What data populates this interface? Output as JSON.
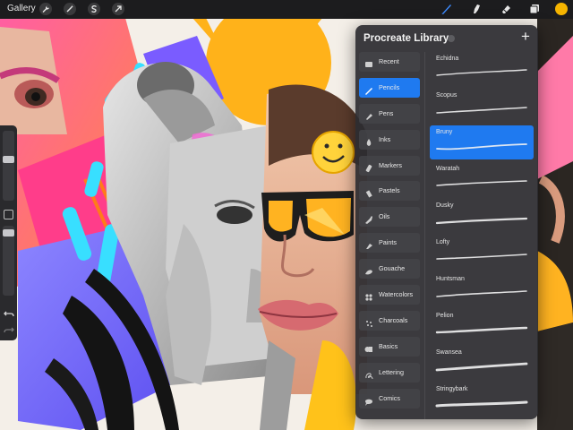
{
  "topbar": {
    "gallery_label": "Gallery",
    "left_tools": [
      {
        "icon": "wrench-icon",
        "name": "actions"
      },
      {
        "icon": "magic-wand-icon",
        "name": "adjustments"
      },
      {
        "icon": "selection-icon",
        "name": "selection"
      },
      {
        "icon": "arrow-cursor-icon",
        "name": "transform"
      }
    ],
    "right_tools": [
      {
        "icon": "brush-icon",
        "name": "paint"
      },
      {
        "icon": "smudge-icon",
        "name": "smudge"
      },
      {
        "icon": "eraser-icon",
        "name": "erase"
      },
      {
        "icon": "layers-icon",
        "name": "layers"
      }
    ],
    "active_tool": "paint",
    "current_color": "#f5b400",
    "accent_color": "#1f7af0"
  },
  "sidebar": {
    "brush_size_level": 0.6,
    "opacity_level": 0.95
  },
  "library": {
    "title": "Procreate Library",
    "add_label": "+",
    "categories": [
      {
        "label": "Recent",
        "icon": "recent-icon"
      },
      {
        "label": "Pencils",
        "icon": "pencil-icon"
      },
      {
        "label": "Pens",
        "icon": "pen-icon"
      },
      {
        "label": "Inks",
        "icon": "ink-icon"
      },
      {
        "label": "Markers",
        "icon": "marker-icon"
      },
      {
        "label": "Pastels",
        "icon": "pastel-icon"
      },
      {
        "label": "Oils",
        "icon": "oil-icon"
      },
      {
        "label": "Paints",
        "icon": "paint-icon"
      },
      {
        "label": "Gouache",
        "icon": "gouache-icon"
      },
      {
        "label": "Watercolors",
        "icon": "watercolor-icon"
      },
      {
        "label": "Charcoals",
        "icon": "charcoal-icon"
      },
      {
        "label": "Basics",
        "icon": "basics-icon"
      },
      {
        "label": "Lettering",
        "icon": "lettering-icon"
      },
      {
        "label": "Comics",
        "icon": "comics-icon"
      }
    ],
    "active_category": "Pencils",
    "brushes": [
      {
        "label": "Echidna"
      },
      {
        "label": "Scopus"
      },
      {
        "label": "Bruny"
      },
      {
        "label": "Waratah"
      },
      {
        "label": "Dusky"
      },
      {
        "label": "Lofty"
      },
      {
        "label": "Huntsman"
      },
      {
        "label": "Pelion"
      },
      {
        "label": "Swansea"
      },
      {
        "label": "Stringybark"
      }
    ],
    "active_brush": "Bruny"
  }
}
